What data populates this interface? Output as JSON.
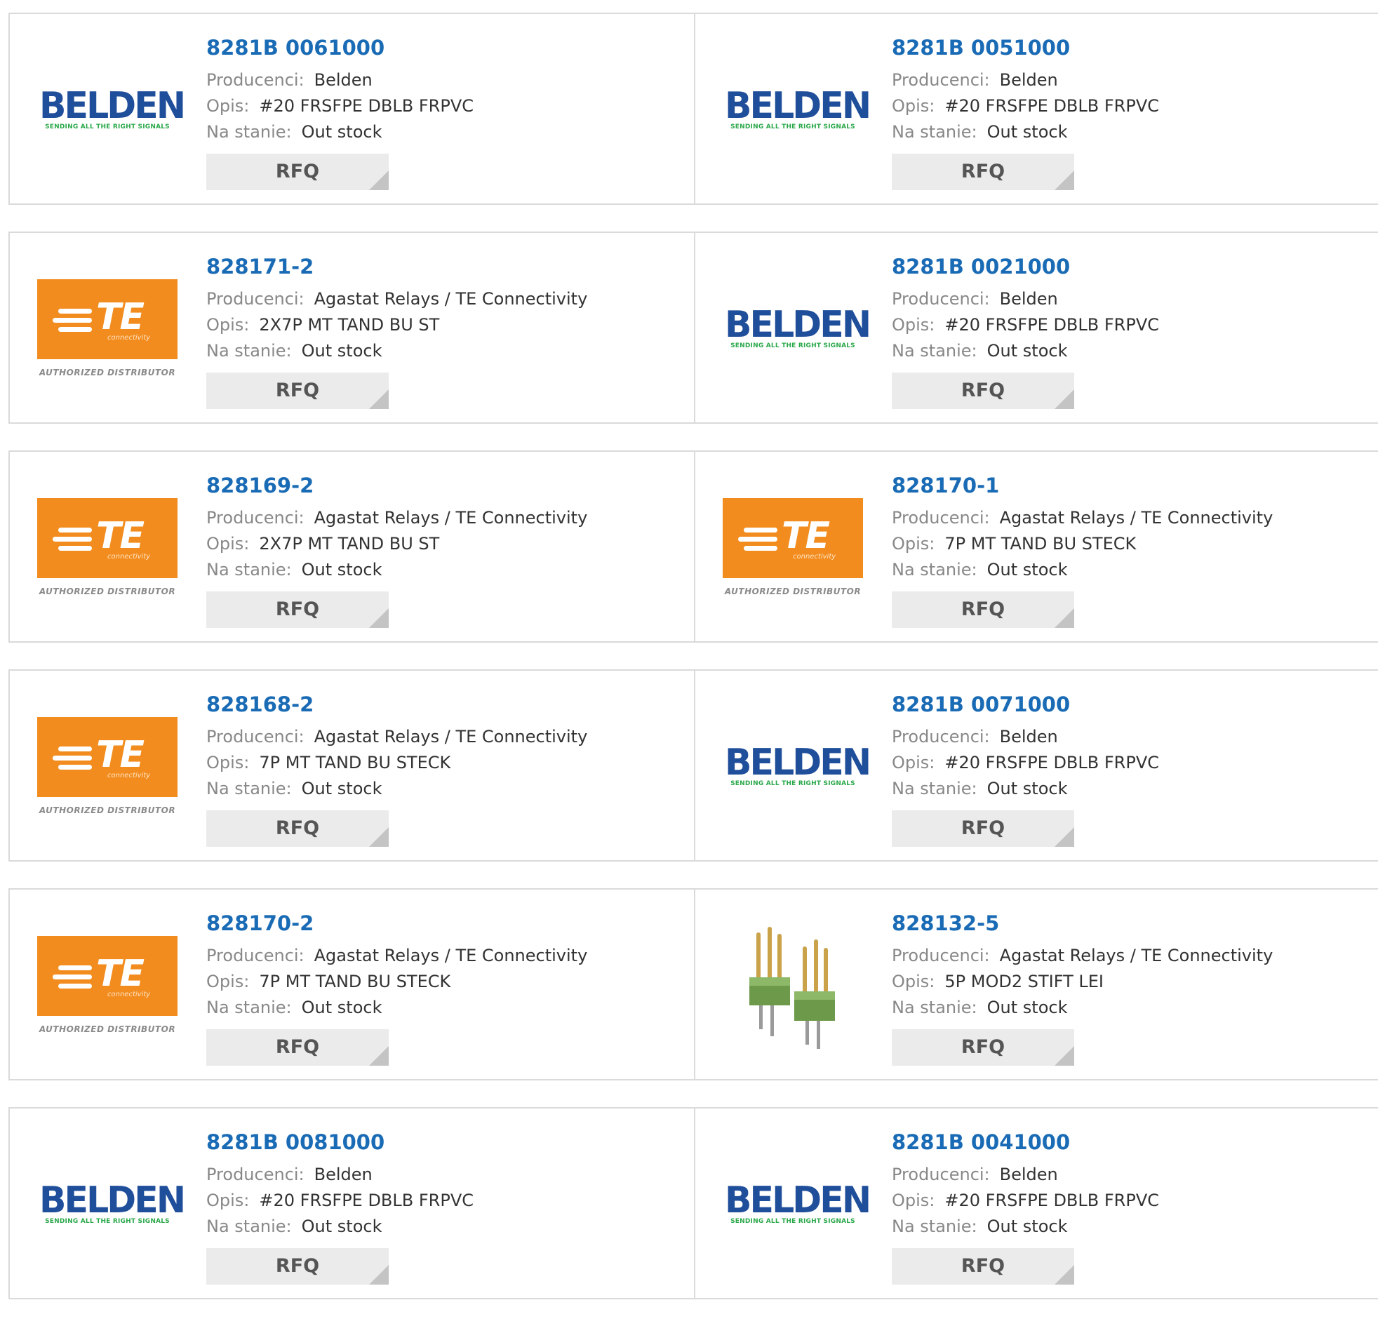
{
  "labels": {
    "manufacturer": "Producenci:",
    "description": "Opis:",
    "stock": "Na stanie:",
    "rfq": "RFQ"
  },
  "logo_text": {
    "belden_word": "BELDEN",
    "belden_tag": "SENDING ALL THE RIGHT SIGNALS",
    "te_word": "TE",
    "te_sub": "connectivity",
    "te_auth": "AUTHORIZED DISTRIBUTOR"
  },
  "products": [
    {
      "part_number": "8281B 0061000",
      "manufacturer": "Belden",
      "description": "#20 FRSFPE DBLB FRPVC",
      "stock": "Out stock",
      "logo": "belden-logo"
    },
    {
      "part_number": "8281B 0051000",
      "manufacturer": "Belden",
      "description": "#20 FRSFPE DBLB FRPVC",
      "stock": "Out stock",
      "logo": "belden-logo"
    },
    {
      "part_number": "828171-2",
      "manufacturer": "Agastat Relays / TE Connectivity",
      "description": "2X7P MT TAND BU ST",
      "stock": "Out stock",
      "logo": "te-logo"
    },
    {
      "part_number": "8281B 0021000",
      "manufacturer": "Belden",
      "description": "#20 FRSFPE DBLB FRPVC",
      "stock": "Out stock",
      "logo": "belden-logo"
    },
    {
      "part_number": "828169-2",
      "manufacturer": "Agastat Relays / TE Connectivity",
      "description": "2X7P MT TAND BU ST",
      "stock": "Out stock",
      "logo": "te-logo"
    },
    {
      "part_number": "828170-1",
      "manufacturer": "Agastat Relays / TE Connectivity",
      "description": "7P MT TAND BU STECK",
      "stock": "Out stock",
      "logo": "te-logo"
    },
    {
      "part_number": "828168-2",
      "manufacturer": "Agastat Relays / TE Connectivity",
      "description": "7P MT TAND BU STECK",
      "stock": "Out stock",
      "logo": "te-logo"
    },
    {
      "part_number": "8281B 0071000",
      "manufacturer": "Belden",
      "description": "#20 FRSFPE DBLB FRPVC",
      "stock": "Out stock",
      "logo": "belden-logo"
    },
    {
      "part_number": "828170-2",
      "manufacturer": "Agastat Relays / TE Connectivity",
      "description": "7P MT TAND BU STECK",
      "stock": "Out stock",
      "logo": "te-logo"
    },
    {
      "part_number": "828132-5",
      "manufacturer": "Agastat Relays / TE Connectivity",
      "description": "5P MOD2 STIFT LEI",
      "stock": "Out stock",
      "logo": "pin-header-photo"
    },
    {
      "part_number": "8281B 0081000",
      "manufacturer": "Belden",
      "description": "#20 FRSFPE DBLB FRPVC",
      "stock": "Out stock",
      "logo": "belden-logo"
    },
    {
      "part_number": "8281B 0041000",
      "manufacturer": "Belden",
      "description": "#20 FRSFPE DBLB FRPVC",
      "stock": "Out stock",
      "logo": "belden-logo"
    }
  ],
  "colors": {
    "part_link": "#1a6bb5",
    "te_orange": "#f28c1e",
    "belden_blue": "#1f4e9a",
    "belden_green": "#2aa84a",
    "rfq_bg": "#ebebeb",
    "border": "#dadada"
  }
}
